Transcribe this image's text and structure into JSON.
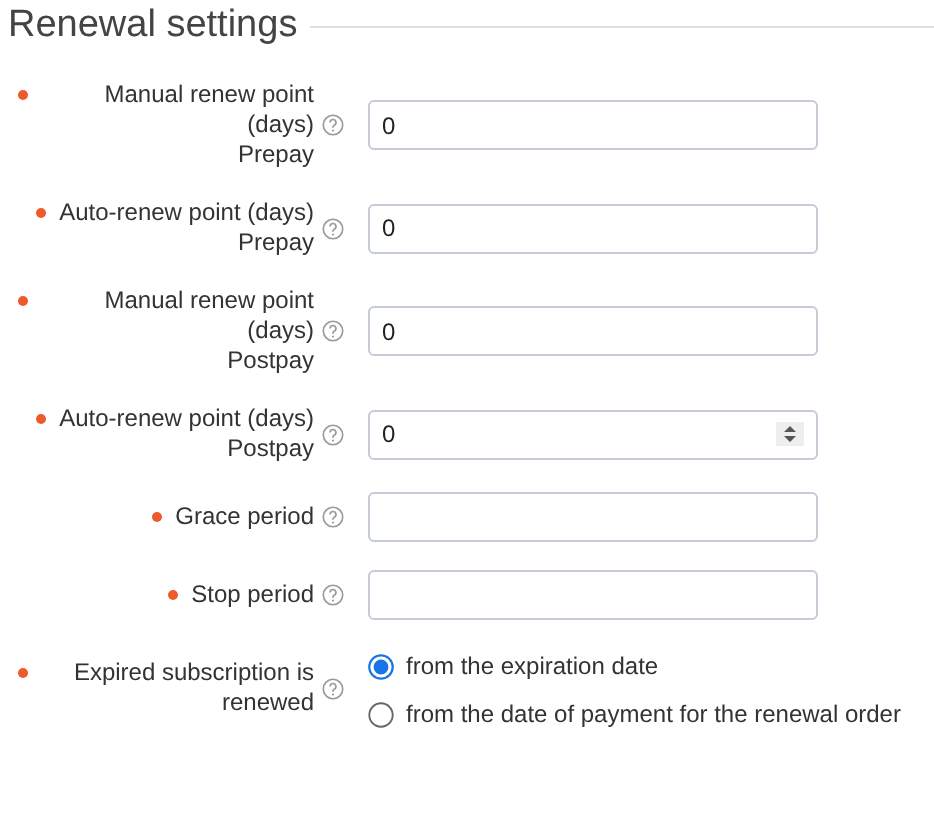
{
  "section": {
    "title": "Renewal settings"
  },
  "fields": [
    {
      "kind": "text",
      "label": "Manual renew point (days)",
      "sublabel": "Prepay",
      "required": true,
      "value": "0"
    },
    {
      "kind": "text",
      "label": "Auto-renew point (days)",
      "sublabel": "Prepay",
      "required": true,
      "value": "0"
    },
    {
      "kind": "text",
      "label": "Manual renew point (days)",
      "sublabel": "Postpay",
      "required": true,
      "value": "0"
    },
    {
      "kind": "number",
      "label": "Auto-renew point (days)",
      "sublabel": "Postpay",
      "required": true,
      "value": "0"
    },
    {
      "kind": "text",
      "label": "Grace period",
      "required": true
    },
    {
      "kind": "text",
      "label": "Stop period",
      "required": true
    },
    {
      "kind": "radio",
      "label": "Expired subscription is renewed",
      "required": true,
      "options": [
        {
          "label": "from the expiration date",
          "selected": true
        },
        {
          "label": "from the date of payment for the renewal order",
          "selected": false
        }
      ]
    }
  ]
}
